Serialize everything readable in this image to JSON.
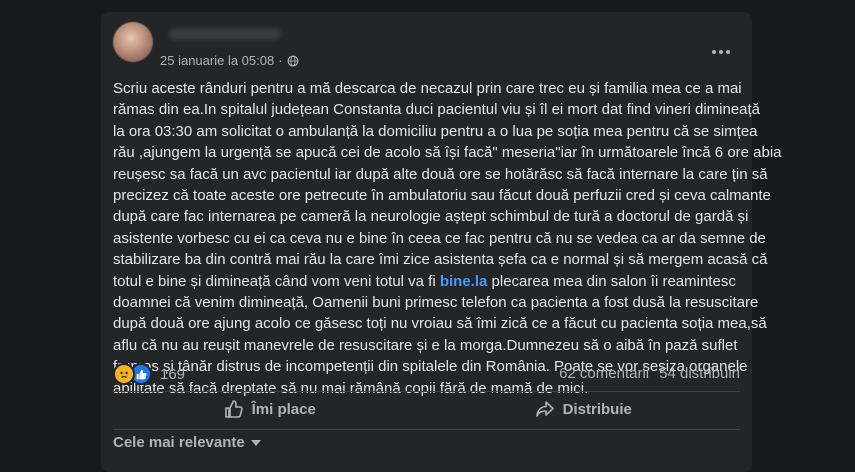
{
  "post": {
    "author": "",
    "date": "25 ianuarie la 05:08",
    "separator": "·",
    "icons": {
      "audience": "globe-icon",
      "more": "more-horizontal-icon"
    },
    "text_lines": [
      "Scriu aceste rânduri pentru a mă descarca de necazul prin care trec eu și familia mea ce a mai",
      "rămas din ea.In spitalul județean Constanta duci pacientul viu și îl ei mort dat find vineri dimineață",
      "la ora 03:30 am solicitat o ambulanță la domiciliu pentru a o lua pe soția mea pentru că se simțea",
      "rău ,ajungem la urgență se apucă cei de acolo să își facă\" meseria\"iar în următoarele încă 6 ore abia",
      "reușesc sa facă un avc pacientul iar după alte două ore se hotărăsc să facă internare la care țin să",
      "precizez că toate aceste ore petrecute în ambulatoriu sau făcut două perfuzii cred și ceva calmante",
      "după care fac internarea pe cameră la neurologie aștept schimbul de tură a doctorul de gardă și",
      "asistente vorbesc cu ei ca ceva nu e bine în ceea ce fac pentru că nu se vedea ca ar da semne de",
      "stabilizare ba din contră mai rău la care îmi zice asistenta șefa ca e normal și să mergem acasă că"
    ],
    "line10_before": "totul e bine și dimineață când vom veni totul va fi ",
    "line10_link": "bine.la",
    "line10_after": " plecarea mea din salon îi reamintesc",
    "text_lines_2": [
      "doamnei că venim dimineață, Oamenii buni primesc telefon ca pacienta a fost dusă la resuscitare",
      "după două ore ajung acolo ce găsesc  toți nu vroiau să îmi zică ce a făcut cu pacienta soția mea,să",
      "aflu că nu au reușit manevrele de resuscitare și e la morga.Dumnezeu să o aibă în pază suflet",
      "frumos și tânăr distrus de incompetenții din spitalele din România. Poate se vor sesiza organele",
      "abilitate să facă dreptate să nu mai rămână copii fără de mamă  de mici."
    ]
  },
  "reactions": {
    "count": "169",
    "icons": [
      "sad-reaction-icon",
      "like-reaction-icon"
    ]
  },
  "stats": {
    "comments": "62 comentarii",
    "shares": "54 distribuiri"
  },
  "actions": {
    "like": "Îmi place",
    "share": "Distribuie"
  },
  "comments": {
    "sort_label": "Cele mai relevante"
  },
  "colors": {
    "background": "#18191a",
    "card": "#242526",
    "text": "#e4e6eb",
    "muted": "#b0b3b8",
    "link": "#4599ff"
  }
}
